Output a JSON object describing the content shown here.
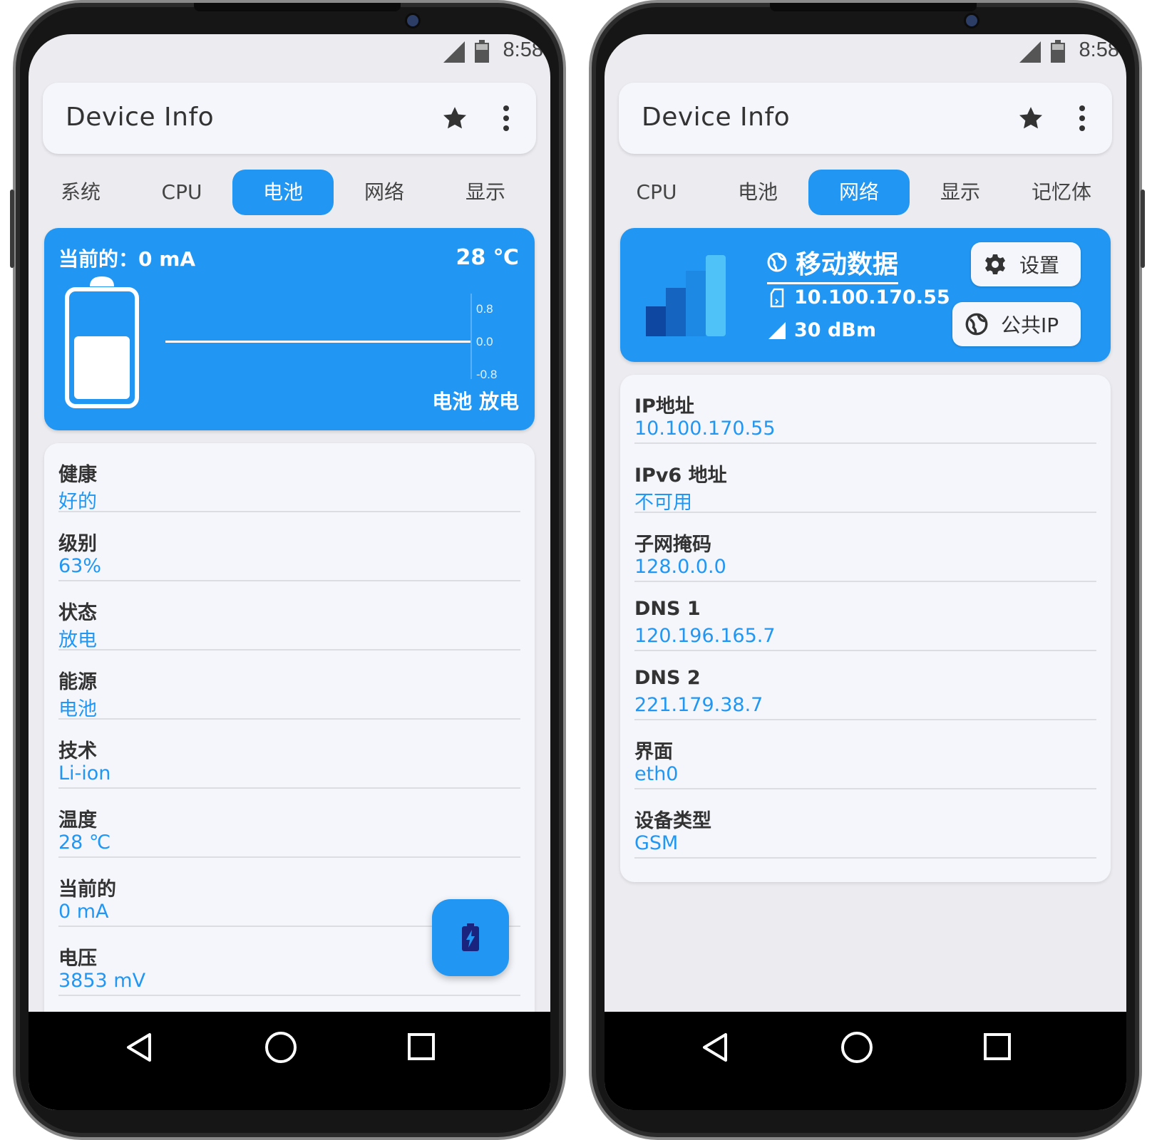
{
  "status_bar": {
    "time": "8:58"
  },
  "left": {
    "app_title": "Device Info",
    "tabs": [
      {
        "label": "系统"
      },
      {
        "label": "CPU"
      },
      {
        "label": "电池",
        "active": true
      },
      {
        "label": "网络"
      },
      {
        "label": "显示"
      }
    ],
    "banner": {
      "current": "当前的：0 mA",
      "temperature": "28 ℃",
      "status": "电池 放电",
      "ticks": [
        "0.8",
        "0.0",
        "-0.8"
      ]
    },
    "rows": [
      {
        "label": "健康",
        "value": "好的"
      },
      {
        "label": "级别",
        "value": "63%"
      },
      {
        "label": "状态",
        "value": "放电"
      },
      {
        "label": "能源",
        "value": "电池"
      },
      {
        "label": "技术",
        "value": "Li-ion"
      },
      {
        "label": "温度",
        "value": "28 ℃"
      },
      {
        "label": "当前的",
        "value": "0 mA"
      },
      {
        "label": "电压",
        "value": "3853 mV"
      }
    ],
    "fab_icon": "battery-charging-icon"
  },
  "right": {
    "app_title": "Device Info",
    "tabs": [
      {
        "label": "CPU"
      },
      {
        "label": "电池"
      },
      {
        "label": "网络",
        "active": true
      },
      {
        "label": "显示"
      },
      {
        "label": "记忆体"
      }
    ],
    "banner": {
      "network_type": "移动数据",
      "ip": "10.100.170.55",
      "signal": "30 dBm",
      "settings_label": "设置",
      "public_ip_label": "公共IP"
    },
    "rows": [
      {
        "label": "IP地址",
        "value": "10.100.170.55"
      },
      {
        "label": "IPv6 地址",
        "value": "不可用"
      },
      {
        "label": "子网掩码",
        "value": "128.0.0.0"
      },
      {
        "label": "DNS 1",
        "value": "120.196.165.7"
      },
      {
        "label": "DNS 2",
        "value": "221.179.38.7"
      },
      {
        "label": "界面",
        "value": "eth0"
      },
      {
        "label": "设备类型",
        "value": "GSM"
      }
    ]
  },
  "colors": {
    "accent": "#2196f3",
    "background": "#ececf0",
    "card": "#f4f6fb"
  }
}
